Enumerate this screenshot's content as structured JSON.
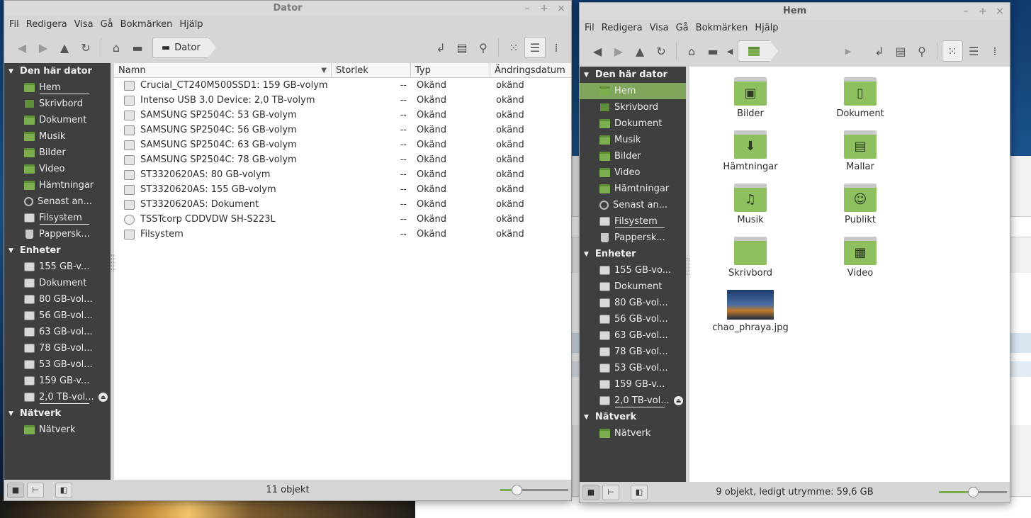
{
  "left_window": {
    "title": "Dator",
    "menu": [
      "Fil",
      "Redigera",
      "Visa",
      "Gå",
      "Bokmärken",
      "Hjälp"
    ],
    "path": "Dator",
    "sidebar": {
      "sections": [
        {
          "header": "Den här dator",
          "items": [
            {
              "label": "Hem",
              "icon": "folder-home"
            },
            {
              "label": "Skrivbord",
              "icon": "desktop"
            },
            {
              "label": "Dokument",
              "icon": "folder"
            },
            {
              "label": "Musik",
              "icon": "folder"
            },
            {
              "label": "Bilder",
              "icon": "folder"
            },
            {
              "label": "Video",
              "icon": "folder"
            },
            {
              "label": "Hämtningar",
              "icon": "folder"
            },
            {
              "label": "Senast an...",
              "icon": "clock"
            },
            {
              "label": "Filsystem",
              "icon": "drive"
            },
            {
              "label": "Pappersk...",
              "icon": "trash"
            }
          ]
        },
        {
          "header": "Enheter",
          "items": [
            {
              "label": "155 GB-v...",
              "icon": "drive"
            },
            {
              "label": "Dokument",
              "icon": "drive"
            },
            {
              "label": "80 GB-vol...",
              "icon": "drive"
            },
            {
              "label": "56 GB-vol...",
              "icon": "drive"
            },
            {
              "label": "63 GB-vol...",
              "icon": "drive"
            },
            {
              "label": "78 GB-vol...",
              "icon": "drive"
            },
            {
              "label": "53 GB-vol...",
              "icon": "drive"
            },
            {
              "label": "159 GB-v...",
              "icon": "drive"
            },
            {
              "label": "2,0 TB-vol...",
              "icon": "drive",
              "eject": true
            }
          ]
        },
        {
          "header": "Nätverk",
          "items": [
            {
              "label": "Nätverk",
              "icon": "folder"
            }
          ]
        }
      ]
    },
    "columns": [
      "Namn",
      "Storlek",
      "Typ",
      "Ändringsdatum"
    ],
    "rows": [
      {
        "name": "Crucial_CT240M500SSD1: 159 GB-volym",
        "size": "--",
        "type": "Okänd",
        "date": "okänd"
      },
      {
        "name": "Intenso USB 3.0 Device: 2,0 TB-volym",
        "size": "--",
        "type": "Okänd",
        "date": "okänd"
      },
      {
        "name": "SAMSUNG SP2504C: 53 GB-volym",
        "size": "--",
        "type": "Okänd",
        "date": "okänd"
      },
      {
        "name": "SAMSUNG SP2504C: 56 GB-volym",
        "size": "--",
        "type": "Okänd",
        "date": "okänd"
      },
      {
        "name": "SAMSUNG SP2504C: 63 GB-volym",
        "size": "--",
        "type": "Okänd",
        "date": "okänd"
      },
      {
        "name": "SAMSUNG SP2504C: 78 GB-volym",
        "size": "--",
        "type": "Okänd",
        "date": "okänd"
      },
      {
        "name": "ST3320620AS: 80 GB-volym",
        "size": "--",
        "type": "Okänd",
        "date": "okänd"
      },
      {
        "name": "ST3320620AS: 155 GB-volym",
        "size": "--",
        "type": "Okänd",
        "date": "okänd"
      },
      {
        "name": "ST3320620AS: Dokument",
        "size": "--",
        "type": "Okänd",
        "date": "okänd"
      },
      {
        "name": "TSSTcorp CDDVDW SH-S223L",
        "size": "--",
        "type": "Okänd",
        "date": "okänd",
        "disc": true
      },
      {
        "name": "Filsystem",
        "size": "--",
        "type": "Okänd",
        "date": "okänd"
      }
    ],
    "status": "11 objekt",
    "zoom_fraction": 0.2
  },
  "right_window": {
    "title": "Hem",
    "menu": [
      "Fil",
      "Redigera",
      "Visa",
      "Gå",
      "Bokmärken",
      "Hjälp"
    ],
    "sidebar": {
      "sections": [
        {
          "header": "Den här dator",
          "items": [
            {
              "label": "Hem",
              "icon": "folder-home",
              "selected": true
            },
            {
              "label": "Skrivbord",
              "icon": "desktop"
            },
            {
              "label": "Dokument",
              "icon": "folder"
            },
            {
              "label": "Musik",
              "icon": "folder"
            },
            {
              "label": "Bilder",
              "icon": "folder"
            },
            {
              "label": "Video",
              "icon": "folder"
            },
            {
              "label": "Hämtningar",
              "icon": "folder"
            },
            {
              "label": "Senast an...",
              "icon": "clock"
            },
            {
              "label": "Filsystem",
              "icon": "drive"
            },
            {
              "label": "Pappersk...",
              "icon": "trash"
            }
          ]
        },
        {
          "header": "Enheter",
          "items": [
            {
              "label": "155 GB-vo...",
              "icon": "drive"
            },
            {
              "label": "Dokument",
              "icon": "drive"
            },
            {
              "label": "80 GB-vol...",
              "icon": "drive"
            },
            {
              "label": "56 GB-vol...",
              "icon": "drive"
            },
            {
              "label": "63 GB-vol...",
              "icon": "drive"
            },
            {
              "label": "78 GB-vol...",
              "icon": "drive"
            },
            {
              "label": "53 GB-vol...",
              "icon": "drive"
            },
            {
              "label": "159 GB-v...",
              "icon": "drive"
            },
            {
              "label": "2,0 TB-vol...",
              "icon": "drive",
              "eject": true
            }
          ]
        },
        {
          "header": "Nätverk",
          "items": [
            {
              "label": "Nätverk",
              "icon": "folder"
            }
          ]
        }
      ]
    },
    "icons": [
      {
        "label": "Bilder",
        "emblem": "▣"
      },
      {
        "label": "Dokument",
        "emblem": "▯"
      },
      {
        "label": "Hämtningar",
        "emblem": "⬇"
      },
      {
        "label": "Mallar",
        "emblem": "▤"
      },
      {
        "label": "Musik",
        "emblem": "♫"
      },
      {
        "label": "Publikt",
        "emblem": "☺"
      },
      {
        "label": "Skrivbord",
        "emblem": ""
      },
      {
        "label": "Video",
        "emblem": "▦"
      },
      {
        "label": "chao_phraya.jpg",
        "image": true
      }
    ],
    "status": "9 objekt, ledigt utrymme: 59,6 GB",
    "zoom_fraction": 0.5
  },
  "accent_color": "#7fa65a"
}
